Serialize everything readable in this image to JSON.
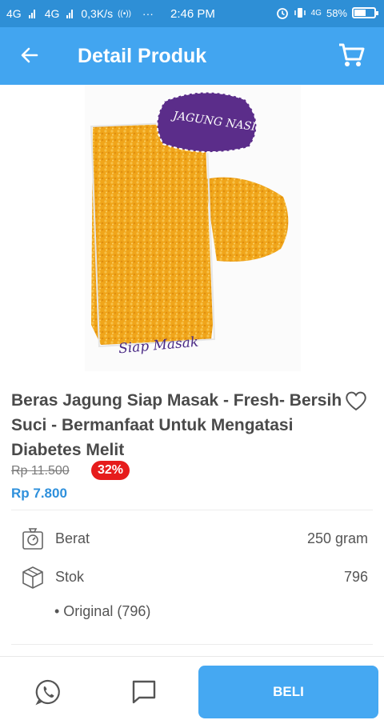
{
  "status_bar": {
    "net1": "4G",
    "net2": "4G",
    "speed": "0,3K/s",
    "more": "···",
    "time": "2:46 PM",
    "net3": "4G",
    "battery": "58%",
    "battery_level": 0.58
  },
  "app_bar": {
    "title": "Detail Produk",
    "back_icon": "arrow-left-icon",
    "cart_icon": "cart-icon"
  },
  "product": {
    "image_label": "JAGUNG NASI",
    "image_caption": "Siap Masak",
    "name": "Beras Jagung Siap Masak - Fresh- Bersih Suci - Bermanfaat Untuk Mengatasi Diabetes Melit",
    "price_original": "Rp 11.500",
    "discount": "32%",
    "price_final": "Rp 7.800"
  },
  "specs": [
    {
      "label": "Berat",
      "value": "250 gram",
      "icon": "scale-icon"
    },
    {
      "label": "Stok",
      "value": "796",
      "icon": "box-icon"
    }
  ],
  "variant": "• Original (796)",
  "bottom_bar": {
    "buy_label": "BELI",
    "whatsapp_icon": "whatsapp-icon",
    "chat_icon": "chat-icon"
  },
  "colors": {
    "status_bar": "#2e8fd6",
    "app_bar": "#42a5f0",
    "price": "#2e90dc",
    "discount": "#e61c1c",
    "buy_button": "#45a8f2"
  }
}
